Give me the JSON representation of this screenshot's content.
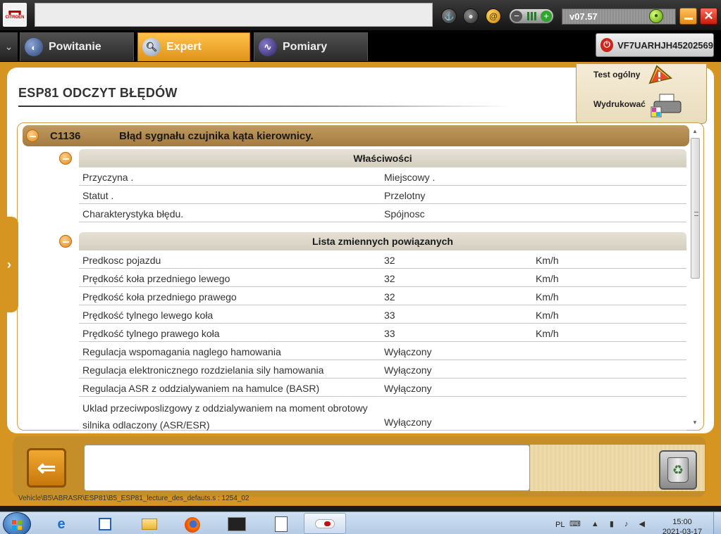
{
  "topbar": {
    "logo_text": "CITROËN",
    "title_field": "",
    "version": "v07.57",
    "colors": {
      "accent": "#d59520",
      "close": "#d01e12",
      "minimize": "#f09a20"
    }
  },
  "nav": {
    "tabs": [
      {
        "label": "Powitanie",
        "icon": "welcome-icon"
      },
      {
        "label": "Expert",
        "icon": "magnifier-icon",
        "active": true
      },
      {
        "label": "Pomiary",
        "icon": "waveform-icon"
      }
    ],
    "vin": "VF7UARHJH45202569"
  },
  "page": {
    "title": "ESP81  ODCZYT BŁĘDÓW",
    "actions": {
      "test": "Test ogólny",
      "print": "Wydrukować"
    }
  },
  "error": {
    "code": "C1136",
    "description": "Błąd sygnału czujnika kąta kierownicy."
  },
  "properties": {
    "header": "Właściwości",
    "rows": [
      {
        "name": "Przyczyna .",
        "value": "Miejscowy ."
      },
      {
        "name": "Statut .",
        "value": "Przelotny"
      },
      {
        "name": "Charakterystyka błędu.",
        "value": "Spójnosc"
      }
    ]
  },
  "variables": {
    "header": "Lista zmiennych powiązanych",
    "rows": [
      {
        "name": "Predkosc pojazdu",
        "value": "32",
        "unit": "Km/h"
      },
      {
        "name": "Prędkość koła przedniego lewego",
        "value": "32",
        "unit": "Km/h"
      },
      {
        "name": "Prędkość koła przedniego prawego",
        "value": "32",
        "unit": "Km/h"
      },
      {
        "name": "Prędkość tylnego lewego koła",
        "value": "33",
        "unit": "Km/h"
      },
      {
        "name": "Prędkość tylnego prawego koła",
        "value": "33",
        "unit": "Km/h"
      },
      {
        "name": "Regulacja wspomagania naglego hamowania",
        "value": "Wyłączony",
        "unit": ""
      },
      {
        "name": "Regulacja elektronicznego rozdzielania sily hamowania",
        "value": "Wyłączony",
        "unit": ""
      },
      {
        "name": "Regulacja ASR z oddzialywaniem na hamulce (BASR)",
        "value": "Wyłączony",
        "unit": ""
      },
      {
        "name": "Uklad przeciwposlizgowy z oddzialywaniem na moment obrotowy silnika odlaczony (ASR/ESR)",
        "value": "Wyłączony",
        "unit": ""
      }
    ]
  },
  "bottom": {
    "message": "",
    "path": "Vehicle\\B5\\ABRASR\\ESP81\\B5_ESP81_lecture_des_defauts.s : 1254_02"
  },
  "taskbar": {
    "language": "PL",
    "time": "15:00",
    "date": "2021-03-17",
    "tray_glyphs": "⌨ ▲ ▮ ♪ ◀"
  }
}
